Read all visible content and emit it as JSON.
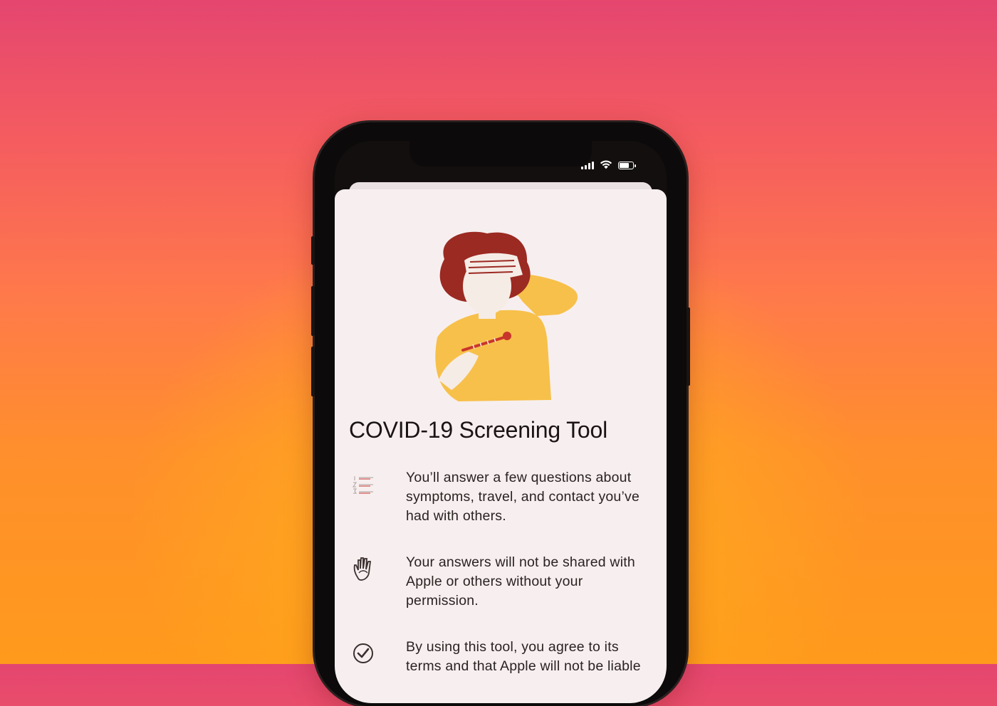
{
  "status_bar": {
    "signal_bars": 4,
    "wifi_icon": "wifi-icon",
    "battery_level": 0.75
  },
  "screen": {
    "title": "COVID-19 Screening Tool",
    "items": [
      {
        "icon": "numbered-list-icon",
        "text": "You’ll answer a few questions about symptoms, travel, and contact you’ve had with others."
      },
      {
        "icon": "hand-icon",
        "text": "Your answers will not be shared with Apple or others without your permission."
      },
      {
        "icon": "checkmark-seal-icon",
        "text": "By using this tool, you agree to its terms and that Apple will not be liable"
      }
    ]
  },
  "colors": {
    "background_top": "#e4466f",
    "background_bottom": "#ff9a1c",
    "sheet": "#f7efef",
    "text": "#1b1414",
    "illustration_hair": "#9b2a22",
    "illustration_shirt": "#f7c04a"
  }
}
